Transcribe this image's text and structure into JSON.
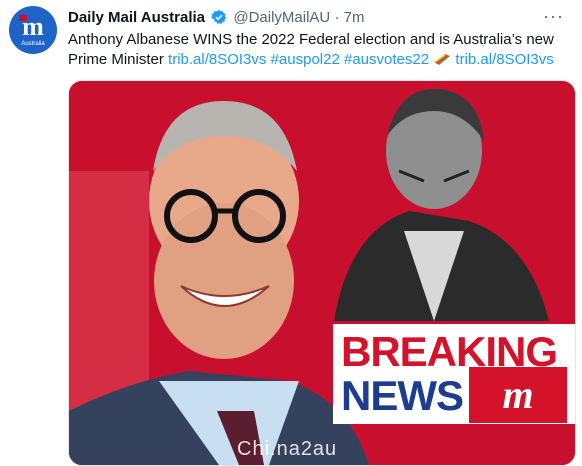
{
  "account": {
    "name": "Daily Mail Australia",
    "handle": "@DailyMailAU",
    "separator": "·",
    "time": "7m",
    "avatar_letter": "m",
    "avatar_sub": "Australia"
  },
  "menu_glyph": "···",
  "tweet": {
    "text": "Anthony Albanese WINS the 2022 Federal election and is Australia’s new Prime Minister",
    "links": [
      "trib.al/8SOI3vs",
      "#auspol22",
      "#ausvotes22",
      "trib.al/8SOI3vs"
    ],
    "emoji": "ballot-box-icon"
  },
  "media": {
    "headline_line1": "BREAKING",
    "headline_line2": "NEWS",
    "logo_text": "m",
    "watermark": "Chi.na2au",
    "background_color": "#c8102e"
  },
  "colors": {
    "link": "#1d9bf0",
    "verified": "#1d9bf0",
    "breaking": "#d4122a",
    "news": "#1d3d8f"
  }
}
